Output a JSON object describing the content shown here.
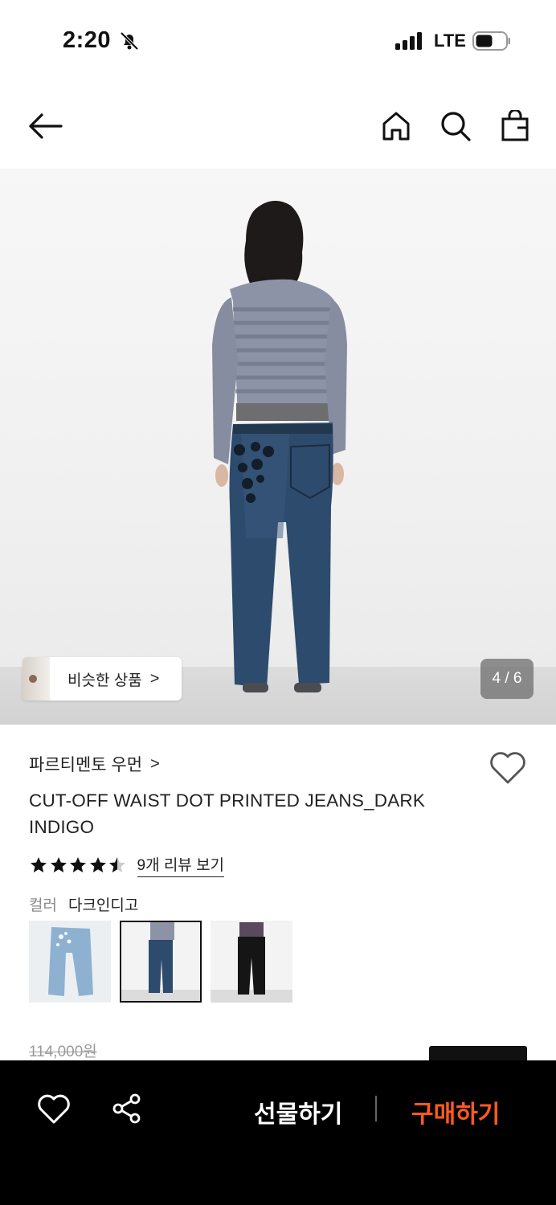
{
  "status_bar": {
    "time": "2:20",
    "network": "LTE",
    "icons": [
      "bell-slash-icon",
      "signal-icon",
      "battery-icon"
    ]
  },
  "nav": {
    "icons": [
      "arrow-left-icon",
      "home-icon",
      "search-icon",
      "shopping-bag-icon"
    ]
  },
  "hero": {
    "similar_products_label": "비슷한 상품",
    "chevron": ">",
    "page_indicator": "4 / 6"
  },
  "product": {
    "brand": "파르티멘토 우먼",
    "brand_chevron": ">",
    "title": "CUT-OFF WAIST DOT PRINTED JEANS_DARK INDIGO",
    "rating": 4.5,
    "review_link": "9개 리뷰 보기",
    "color_label": "컬러",
    "color_value": "다크인디고",
    "swatch_count": 3,
    "selected_swatch": 2,
    "original_price": "114,000원"
  },
  "bottom_bar": {
    "gift_label": "선물하기",
    "buy_label": "구매하기",
    "buy_color": "#ff5a1f",
    "icons": [
      "heart-icon",
      "share-icon"
    ]
  }
}
